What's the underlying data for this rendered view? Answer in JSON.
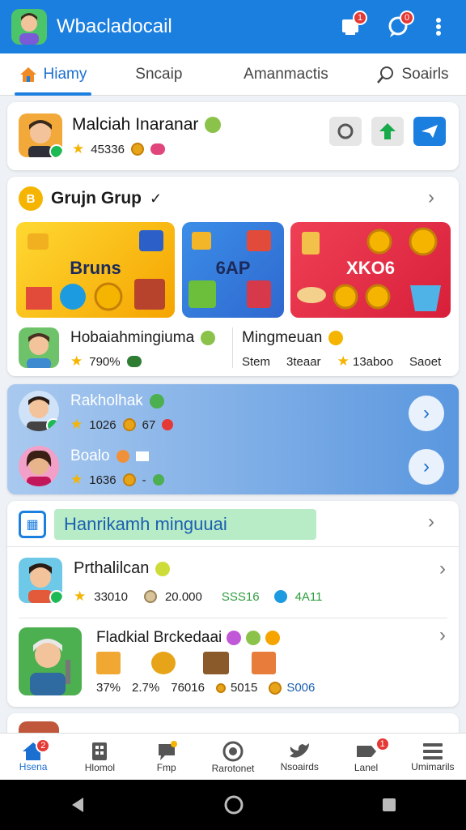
{
  "header": {
    "title": "Wbacladocail",
    "notif_badge": "1",
    "chat_badge": "0"
  },
  "tabs": [
    {
      "label": "Hiamy",
      "icon": "home-icon"
    },
    {
      "label": "Sncaip",
      "icon": ""
    },
    {
      "label": "Amanmactis",
      "icon": ""
    },
    {
      "label": "Soairls",
      "icon": "search-icon"
    }
  ],
  "profile": {
    "name": "Malciah Inaranar",
    "score": "45336"
  },
  "group": {
    "title": "Grujn Grup",
    "tiles": [
      "Bruns",
      "6AP",
      "XKO6"
    ],
    "left_name": "Hobaiahmingiuma",
    "left_pct": "790%",
    "right_name": "Mingmeuan",
    "right_cols": [
      "Stem",
      "3teaar",
      "13aboo",
      "Saoet"
    ]
  },
  "blue": {
    "row1": {
      "name": "Rakholhak",
      "v1": "1026",
      "v2": "67"
    },
    "row2": {
      "name": "Boalo",
      "v1": "1636"
    }
  },
  "section": {
    "title": "Hanrikamh minguuai",
    "item1": {
      "name": "Prthalilcan",
      "v1": "33010",
      "v2": "20.000",
      "v3": "SSS16",
      "v4": "4A11"
    },
    "item2": {
      "name": "Fladkial Brckedaai",
      "vals": [
        "37%",
        "2.7%",
        "76016",
        "5015",
        "S006"
      ]
    }
  },
  "bottom_nav": [
    "Hsena",
    "Hlomol",
    "Fmp",
    "Rarotonet",
    "Nsoairds",
    "Lanel",
    "Umimarils"
  ],
  "bottom_badges": {
    "home": "2",
    "lanel": "1"
  },
  "colors": {
    "primary": "#1b7fe0",
    "accent_green": "#1db954",
    "badge": "#e53935"
  }
}
